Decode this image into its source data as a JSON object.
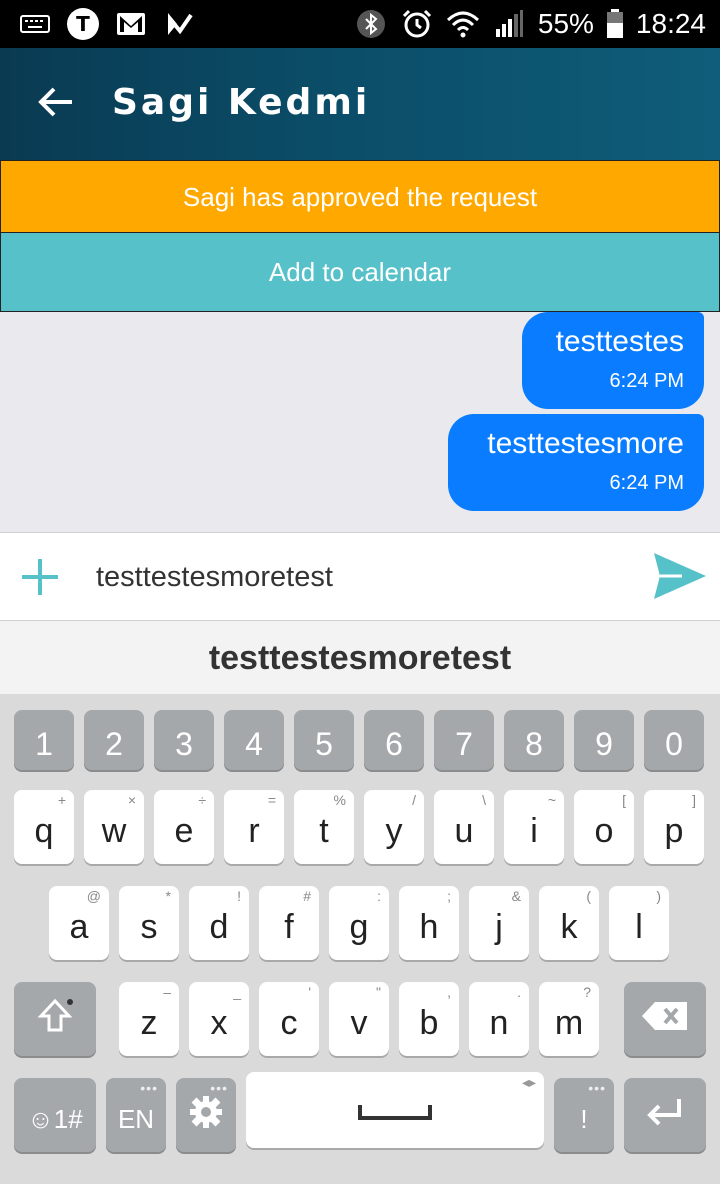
{
  "status_bar": {
    "left_icons": [
      "keyboard-icon",
      "t-app-icon",
      "gmail-icon",
      "check-app-icon"
    ],
    "battery": "55%",
    "time": "18:24"
  },
  "app_bar": {
    "title": "Sagi Kedmi",
    "back_icon": "back-arrow-icon"
  },
  "banners": {
    "approved": "Sagi has approved the request",
    "calendar": "Add to calendar"
  },
  "messages": [
    {
      "text": "testtestes",
      "time": "6:24 PM"
    },
    {
      "text": "testtestesmore",
      "time": "6:24 PM"
    }
  ],
  "composer": {
    "value": "testtestesmoretest",
    "plus_icon": "plus-icon",
    "send_icon": "send-icon"
  },
  "suggestion": "testtestesmoretest",
  "keyboard": {
    "numbers": [
      "1",
      "2",
      "3",
      "4",
      "5",
      "6",
      "7",
      "8",
      "9",
      "0"
    ],
    "row1": [
      [
        "q",
        "+"
      ],
      [
        "w",
        "×"
      ],
      [
        "e",
        "÷"
      ],
      [
        "r",
        "="
      ],
      [
        "t",
        "%"
      ],
      [
        "y",
        "/"
      ],
      [
        "u",
        "\\"
      ],
      [
        "i",
        "~"
      ],
      [
        "o",
        "["
      ],
      [
        "p",
        "]"
      ]
    ],
    "row2": [
      [
        "a",
        "@"
      ],
      [
        "s",
        "*"
      ],
      [
        "d",
        "!"
      ],
      [
        "f",
        "#"
      ],
      [
        "g",
        ":"
      ],
      [
        "h",
        ";"
      ],
      [
        "j",
        "&"
      ],
      [
        "k",
        "("
      ],
      [
        "l",
        ")"
      ]
    ],
    "row3": [
      [
        "z",
        "–"
      ],
      [
        "x",
        "_"
      ],
      [
        "c",
        "'"
      ],
      [
        "v",
        "\""
      ],
      [
        "b",
        ","
      ],
      [
        "n",
        "."
      ],
      [
        "m",
        "?"
      ]
    ],
    "symbols_label": "☺1#",
    "lang_label": "EN",
    "punct_label": "!",
    "colors": {
      "accent": "#56c1c9",
      "bubble": "#0a7cff",
      "banner": "#ffa800"
    }
  }
}
